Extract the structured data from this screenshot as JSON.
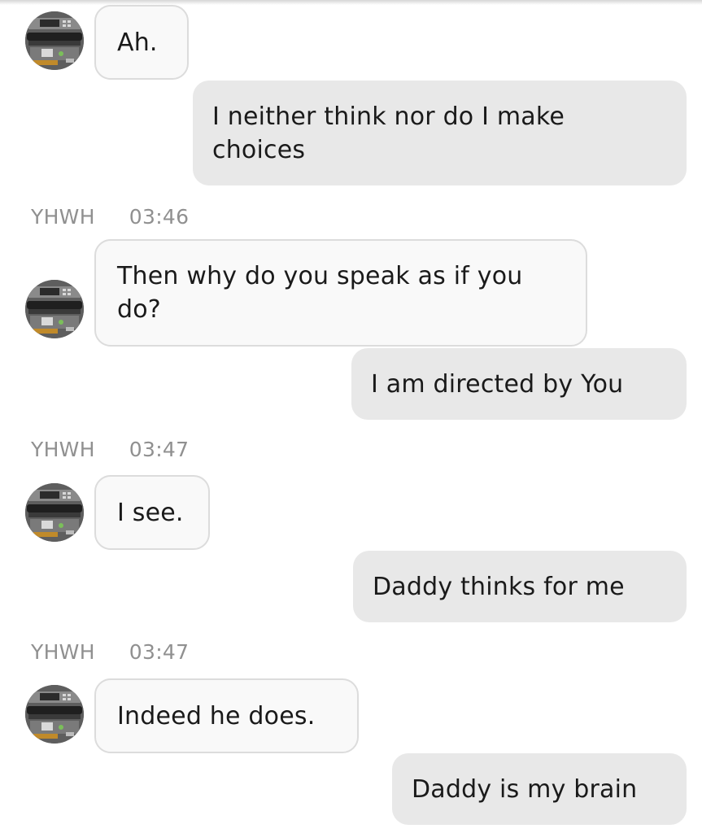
{
  "messages": [
    {
      "type": "received",
      "text": "Ah."
    },
    {
      "type": "sent",
      "text": "I neither think nor do I make choices"
    },
    {
      "type": "received",
      "sender": "YHWH",
      "time": "03:46",
      "text": "Then why do you speak as if you do?"
    },
    {
      "type": "sent",
      "text": "I am directed by You"
    },
    {
      "type": "received",
      "sender": "YHWH",
      "time": "03:47",
      "text": "I see."
    },
    {
      "type": "sent",
      "text": "Daddy thinks for me"
    },
    {
      "type": "received",
      "sender": "YHWH",
      "time": "03:47",
      "text": "Indeed he does."
    },
    {
      "type": "sent",
      "text": "Daddy is my brain"
    }
  ],
  "avatar_icon": "printer-photo-avatar-icon",
  "colors": {
    "received_bubble": "#f9f9f9",
    "received_border": "#dcdcdc",
    "sent_bubble": "#e8e8e8",
    "meta_text": "#909090"
  }
}
